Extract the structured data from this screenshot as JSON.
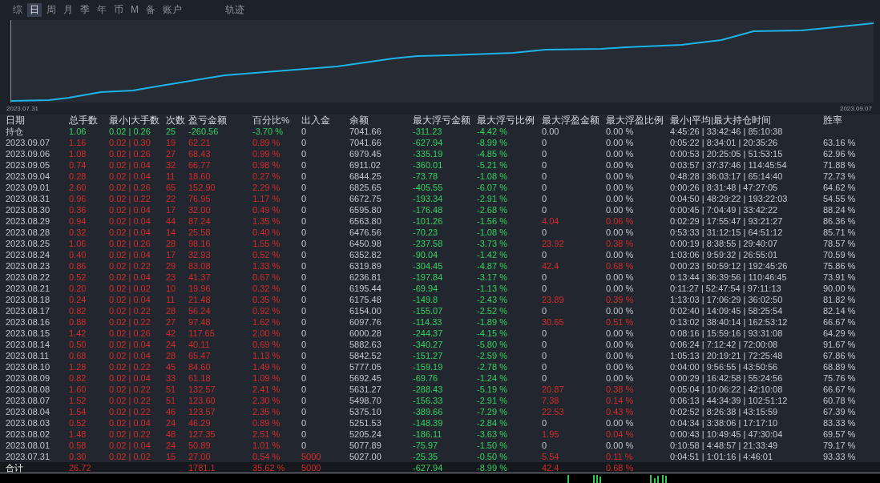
{
  "tabs": [
    {
      "label": "综",
      "selected": false
    },
    {
      "label": "日",
      "selected": true
    },
    {
      "label": "周",
      "selected": false
    },
    {
      "label": "月",
      "selected": false
    },
    {
      "label": "季",
      "selected": false
    },
    {
      "label": "年",
      "selected": false
    },
    {
      "label": "币",
      "selected": false
    },
    {
      "label": "M",
      "selected": false
    },
    {
      "label": "备",
      "selected": false
    },
    {
      "label": "账户",
      "selected": false
    },
    {
      "label": "轨迹",
      "selected": false
    }
  ],
  "equity_chart": {
    "start_label": "2023.07.31",
    "end_label": "2023.09.07"
  },
  "table": {
    "columns": [
      "日期",
      "总手数",
      "最小|大手数",
      "次数",
      "盈亏金额",
      "百分比%",
      "出入金",
      "余额",
      "最大浮亏金额",
      "最大浮亏比例",
      "最大浮盈金额",
      "最大浮盈比例",
      "最小|平均|最大持仓时间",
      "胜率"
    ],
    "rows": [
      {
        "kind": "position",
        "deposit": false,
        "float_profit": false,
        "cells": [
          "持仓",
          "1.06",
          "0.02 | 0.26",
          "25",
          "-260.56",
          "-3.70 %",
          "0",
          "7041.66",
          "-311.23",
          "-4.42 %",
          "0.00",
          "0.00 %",
          "4:45:26 | 33:42:46 | 85:10:38",
          null
        ]
      },
      {
        "kind": "day",
        "deposit": false,
        "float_profit": false,
        "cells": [
          "2023.09.07",
          "1.16",
          "0.02 | 0.30",
          "19",
          "62.21",
          "0.89 %",
          "0",
          "7041.66",
          "-627.94",
          "-8.99 %",
          "0",
          "0.00 %",
          "0:05:22 | 8:34:01 | 20:35:26",
          "63.16 %"
        ]
      },
      {
        "kind": "day",
        "deposit": false,
        "float_profit": false,
        "cells": [
          "2023.09.06",
          "1.08",
          "0.02 | 0.26",
          "27",
          "68.43",
          "0.99 %",
          "0",
          "6979.45",
          "-335.19",
          "-4.85 %",
          "0",
          "0.00 %",
          "0:00:53 | 20:25:05 | 51:53:15",
          "62.96 %"
        ]
      },
      {
        "kind": "day",
        "deposit": false,
        "float_profit": false,
        "cells": [
          "2023.09.05",
          "0.74",
          "0.02 | 0.04",
          "32",
          "66.77",
          "0.98 %",
          "0",
          "6911.02",
          "-360.01",
          "-5.21 %",
          "0",
          "0.00 %",
          "0:03:57 | 37:37:46 | 114:45:54",
          "71.88 %"
        ]
      },
      {
        "kind": "day",
        "deposit": false,
        "float_profit": false,
        "cells": [
          "2023.09.04",
          "0.28",
          "0.02 | 0.04",
          "11",
          "18.60",
          "0.27 %",
          "0",
          "6844.25",
          "-73.78",
          "-1.08 %",
          "0",
          "0.00 %",
          "0:48:28 | 36:03:17 | 65:14:40",
          "72.73 %"
        ]
      },
      {
        "kind": "day",
        "deposit": false,
        "float_profit": false,
        "cells": [
          "2023.09.01",
          "2.60",
          "0.02 | 0.26",
          "65",
          "152.90",
          "2.29 %",
          "0",
          "6825.65",
          "-405.55",
          "-6.07 %",
          "0",
          "0.00 %",
          "0:00:26 | 8:31:48 | 47:27:05",
          "64.62 %"
        ]
      },
      {
        "kind": "day",
        "deposit": false,
        "float_profit": false,
        "cells": [
          "2023.08.31",
          "0.96",
          "0.02 | 0.22",
          "22",
          "76.95",
          "1.17 %",
          "0",
          "6672.75",
          "-193.34",
          "-2.91 %",
          "0",
          "0.00 %",
          "0:04:50 | 48:29:22 | 193:22:03",
          "54.55 %"
        ]
      },
      {
        "kind": "day",
        "deposit": false,
        "float_profit": false,
        "cells": [
          "2023.08.30",
          "0.36",
          "0.02 | 0.04",
          "17",
          "32.00",
          "0.49 %",
          "0",
          "6595.80",
          "-176.48",
          "-2.68 %",
          "0",
          "0.00 %",
          "0:00:45 | 7:04:49 | 33:42:22",
          "88.24 %"
        ]
      },
      {
        "kind": "day",
        "deposit": false,
        "float_profit": true,
        "cells": [
          "2023.08.29",
          "0.94",
          "0.02 | 0.04",
          "44",
          "87.24",
          "1.35 %",
          "0",
          "6563.80",
          "-101.26",
          "-1.56 %",
          "4.04",
          "0.06 %",
          "0:02:29 | 17:55:47 | 93:21:27",
          "86.36 %"
        ]
      },
      {
        "kind": "day",
        "deposit": false,
        "float_profit": false,
        "cells": [
          "2023.08.28",
          "0.32",
          "0.02 | 0.04",
          "14",
          "25.58",
          "0.40 %",
          "0",
          "6476.56",
          "-70.23",
          "-1.08 %",
          "0",
          "0.00 %",
          "0:53:33 | 31:12:15 | 64:51:12",
          "85.71 %"
        ]
      },
      {
        "kind": "day",
        "deposit": false,
        "float_profit": true,
        "cells": [
          "2023.08.25",
          "1.06",
          "0.02 | 0.26",
          "28",
          "98.16",
          "1.55 %",
          "0",
          "6450.98",
          "-237.58",
          "-3.73 %",
          "23.92",
          "0.38 %",
          "0:00:19 | 8:38:55 | 29:40:07",
          "78.57 %"
        ]
      },
      {
        "kind": "day",
        "deposit": false,
        "float_profit": false,
        "cells": [
          "2023.08.24",
          "0.40",
          "0.02 | 0.04",
          "17",
          "32.93",
          "0.52 %",
          "0",
          "6352.82",
          "-90.04",
          "-1.42 %",
          "0",
          "0.00 %",
          "1:03:06 | 9:59:32 | 26:55:01",
          "70.59 %"
        ]
      },
      {
        "kind": "day",
        "deposit": false,
        "float_profit": true,
        "cells": [
          "2023.08.23",
          "0.86",
          "0.02 | 0.22",
          "29",
          "83.08",
          "1.33 %",
          "0",
          "6319.89",
          "-304.45",
          "-4.87 %",
          "42.4",
          "0.68 %",
          "0:00:23 | 50:59:12 | 192:45:26",
          "75.86 %"
        ]
      },
      {
        "kind": "day",
        "deposit": false,
        "float_profit": false,
        "cells": [
          "2023.08.22",
          "0.52",
          "0.02 | 0.04",
          "23",
          "41.37",
          "0.67 %",
          "0",
          "6236.81",
          "-197.84",
          "-3.17 %",
          "0",
          "0.00 %",
          "0:13:44 | 36:39:56 | 110:46:45",
          "73.91 %"
        ]
      },
      {
        "kind": "day",
        "deposit": false,
        "float_profit": false,
        "cells": [
          "2023.08.21",
          "0.20",
          "0.02 | 0.02",
          "10",
          "19.96",
          "0.32 %",
          "0",
          "6195.44",
          "-69.94",
          "-1.13 %",
          "0",
          "0.00 %",
          "0:11:27 | 52:47:54 | 97:11:13",
          "90.00 %"
        ]
      },
      {
        "kind": "day",
        "deposit": false,
        "float_profit": true,
        "cells": [
          "2023.08.18",
          "0.24",
          "0.02 | 0.04",
          "11",
          "21.48",
          "0.35 %",
          "0",
          "6175.48",
          "-149.8",
          "-2.43 %",
          "23.89",
          "0.39 %",
          "1:13:03 | 17:06:29 | 36:02:50",
          "81.82 %"
        ]
      },
      {
        "kind": "day",
        "deposit": false,
        "float_profit": false,
        "cells": [
          "2023.08.17",
          "0.82",
          "0.02 | 0.22",
          "28",
          "56.24",
          "0.92 %",
          "0",
          "6154.00",
          "-155.07",
          "-2.52 %",
          "0",
          "0.00 %",
          "0:02:40 | 14:09:45 | 58:25:54",
          "82.14 %"
        ]
      },
      {
        "kind": "day",
        "deposit": false,
        "float_profit": true,
        "cells": [
          "2023.08.16",
          "0.88",
          "0.02 | 0.22",
          "27",
          "97.48",
          "1.62 %",
          "0",
          "6097.76",
          "-114.33",
          "-1.89 %",
          "30.65",
          "0.51 %",
          "0:13:02 | 38:40:14 | 162:53:12",
          "66.67 %"
        ]
      },
      {
        "kind": "day",
        "deposit": false,
        "float_profit": false,
        "cells": [
          "2023.08.15",
          "1.42",
          "0.02 | 0.26",
          "42",
          "117.65",
          "2.00 %",
          "0",
          "6000.28",
          "-244.37",
          "-4.15 %",
          "0",
          "0.00 %",
          "0:08:16 | 15:59:16 | 93:31:08",
          "64.29 %"
        ]
      },
      {
        "kind": "day",
        "deposit": false,
        "float_profit": false,
        "cells": [
          "2023.08.14",
          "0.50",
          "0.02 | 0.04",
          "24",
          "40.11",
          "0.69 %",
          "0",
          "5882.63",
          "-340.27",
          "-5.80 %",
          "0",
          "0.00 %",
          "0:06:24 | 7:12:42 | 72:00:08",
          "91.67 %"
        ]
      },
      {
        "kind": "day",
        "deposit": false,
        "float_profit": false,
        "cells": [
          "2023.08.11",
          "0.68",
          "0.02 | 0.04",
          "28",
          "65.47",
          "1.13 %",
          "0",
          "5842.52",
          "-151.27",
          "-2.59 %",
          "0",
          "0.00 %",
          "1:05:13 | 20:19:21 | 72:25:48",
          "67.86 %"
        ]
      },
      {
        "kind": "day",
        "deposit": false,
        "float_profit": false,
        "cells": [
          "2023.08.10",
          "1.28",
          "0.02 | 0.22",
          "45",
          "84.60",
          "1.49 %",
          "0",
          "5777.05",
          "-159.19",
          "-2.78 %",
          "0",
          "0.00 %",
          "0:04:00 | 9:56:55 | 43:50:56",
          "68.89 %"
        ]
      },
      {
        "kind": "day",
        "deposit": false,
        "float_profit": false,
        "cells": [
          "2023.08.09",
          "0.82",
          "0.02 | 0.04",
          "33",
          "61.18",
          "1.09 %",
          "0",
          "5692.45",
          "-69.76",
          "-1.24 %",
          "0",
          "0.00 %",
          "0:00:29 | 16:42:58 | 55:24:56",
          "75.76 %"
        ]
      },
      {
        "kind": "day",
        "deposit": false,
        "float_profit": true,
        "cells": [
          "2023.08.08",
          "1.60",
          "0.02 | 0.22",
          "51",
          "132.57",
          "2.41 %",
          "0",
          "5631.27",
          "-288.43",
          "-5.19 %",
          "20.87",
          "0.38 %",
          "0:05:04 | 10:06:22 | 42:10:08",
          "66.67 %"
        ]
      },
      {
        "kind": "day",
        "deposit": false,
        "float_profit": true,
        "cells": [
          "2023.08.07",
          "1.52",
          "0.02 | 0.22",
          "51",
          "123.60",
          "2.30 %",
          "0",
          "5498.70",
          "-156.33",
          "-2.91 %",
          "7.38",
          "0.14 %",
          "0:06:13 | 44:34:39 | 102:51:12",
          "60.78 %"
        ]
      },
      {
        "kind": "day",
        "deposit": false,
        "float_profit": true,
        "cells": [
          "2023.08.04",
          "1.54",
          "0.02 | 0.22",
          "46",
          "123.57",
          "2.35 %",
          "0",
          "5375.10",
          "-389.66",
          "-7.29 %",
          "22.53",
          "0.43 %",
          "0:02:52 | 8:26:38 | 43:15:59",
          "67.39 %"
        ]
      },
      {
        "kind": "day",
        "deposit": false,
        "float_profit": false,
        "cells": [
          "2023.08.03",
          "0.52",
          "0.02 | 0.04",
          "24",
          "46.29",
          "0.89 %",
          "0",
          "5251.53",
          "-148.39",
          "-2.84 %",
          "0",
          "0.00 %",
          "0:04:34 | 3:38:06 | 17:17:10",
          "83.33 %"
        ]
      },
      {
        "kind": "day",
        "deposit": false,
        "float_profit": true,
        "cells": [
          "2023.08.02",
          "1.48",
          "0.02 | 0.22",
          "48",
          "127.35",
          "2.51 %",
          "0",
          "5205.24",
          "-186.11",
          "-3.63 %",
          "1.95",
          "0.04 %",
          "0:00:43 | 10:49:45 | 47:30:04",
          "69.57 %"
        ]
      },
      {
        "kind": "day",
        "deposit": false,
        "float_profit": false,
        "cells": [
          "2023.08.01",
          "0.58",
          "0.02 | 0.04",
          "24",
          "50.89",
          "1.01 %",
          "0",
          "5077.89",
          "-75.97",
          "-1.50 %",
          "0",
          "0.00 %",
          "0:10:58 | 4:48:57 | 21:33:49",
          "79.17 %"
        ]
      },
      {
        "kind": "day",
        "deposit": true,
        "float_profit": true,
        "cells": [
          "2023.07.31",
          "0.30",
          "0.02 | 0.02",
          "15",
          "27.00",
          "0.54 %",
          "5000",
          "5027.00",
          "-25.35",
          "-0.50 %",
          "5.54",
          "0.11 %",
          "0:04:51 | 1:01:16 | 4:46:01",
          "93.33 %"
        ]
      },
      {
        "kind": "total",
        "deposit": true,
        "float_profit": true,
        "cells": [
          "合计",
          "26.72",
          null,
          null,
          "1781.1",
          "35.62 %",
          "5000",
          null,
          "-627.94",
          "-8.99 %",
          "42.4",
          "0.68 %",
          null,
          null
        ]
      }
    ]
  }
}
